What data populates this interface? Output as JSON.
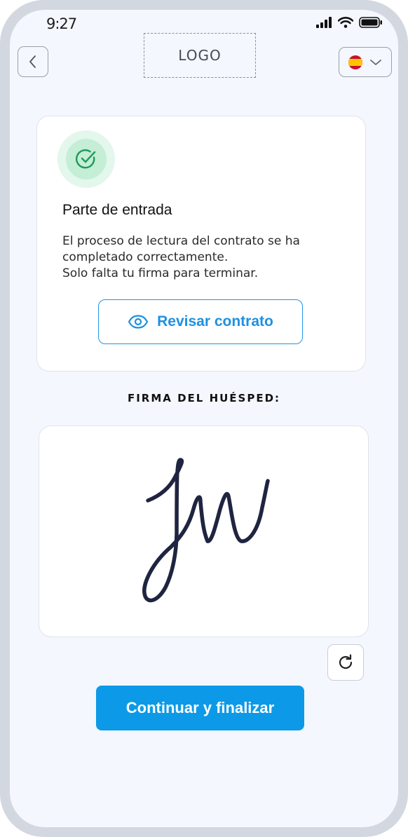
{
  "status_bar": {
    "time": "9:27"
  },
  "header": {
    "back_icon": "chevron-left-icon",
    "logo_text": "LOGO",
    "language_flag": "spain-flag",
    "language_dropdown_icon": "chevron-down-icon"
  },
  "card": {
    "status_icon": "check-circle-icon",
    "title": "Parte de entrada",
    "lines": [
      "El proceso de lectura del contrato se ha",
      "completado correctamente.",
      "Solo falta tu firma para terminar."
    ],
    "review_button_label": "Revisar contrato",
    "review_button_icon": "eye-icon"
  },
  "signature": {
    "label": "FIRMA DEL HUÉSPED:",
    "redo_icon": "redo-icon"
  },
  "continue_button_label": "Continuar y finalizar",
  "colors": {
    "accent": "#0c9ae8",
    "success": "#1f9a5a",
    "signature_ink": "#1f2440"
  }
}
